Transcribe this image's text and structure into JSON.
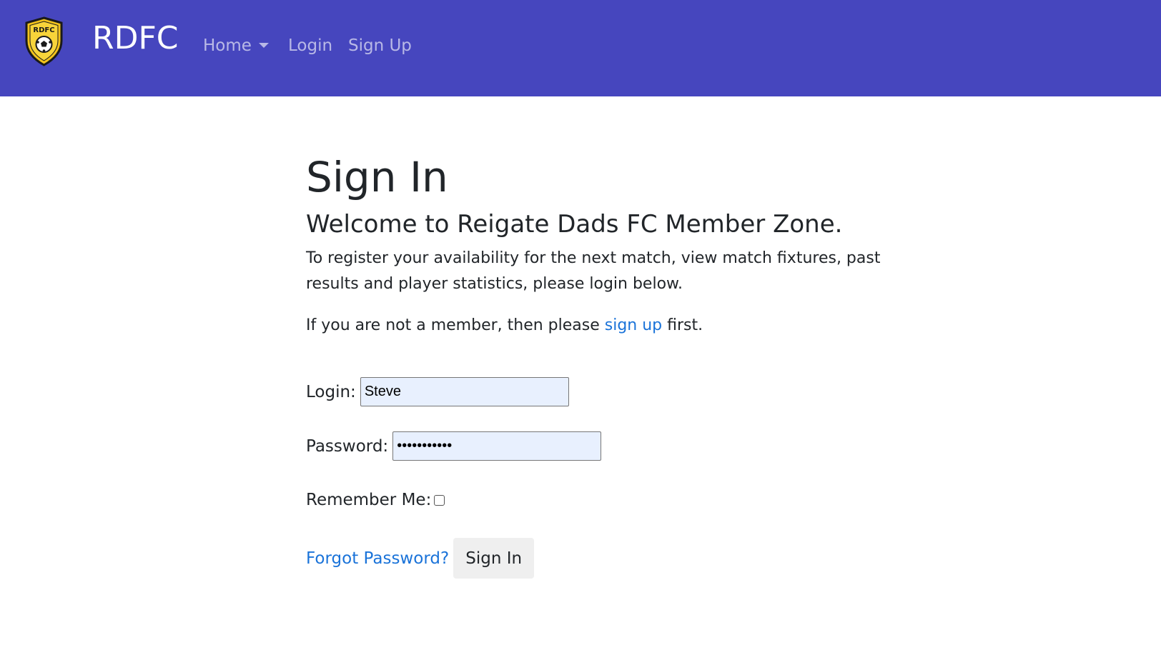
{
  "header": {
    "logo_text": "RDFC",
    "brand": "RDFC",
    "nav": {
      "home": "Home",
      "login": "Login",
      "signup": "Sign Up"
    },
    "bg_color": "#4646be"
  },
  "page": {
    "title": "Sign In",
    "subtitle": "Welcome to Reigate Dads FC Member Zone.",
    "intro": "To register your availability for the next match, view match fixtures, past results and player statistics, please login below.",
    "signup_note": {
      "before": "If you are not a member, then please ",
      "link": "sign up",
      "after": " first."
    }
  },
  "form": {
    "login_label": "Login:",
    "login_value": "Steve",
    "password_label": "Password:",
    "password_value": "•••••••••••",
    "remember_label": "Remember Me:",
    "remember_checked": false,
    "forgot_label": "Forgot Password?",
    "submit_label": "Sign In"
  },
  "colors": {
    "link": "#1a73d9",
    "input_bg": "#e8f0fe"
  }
}
